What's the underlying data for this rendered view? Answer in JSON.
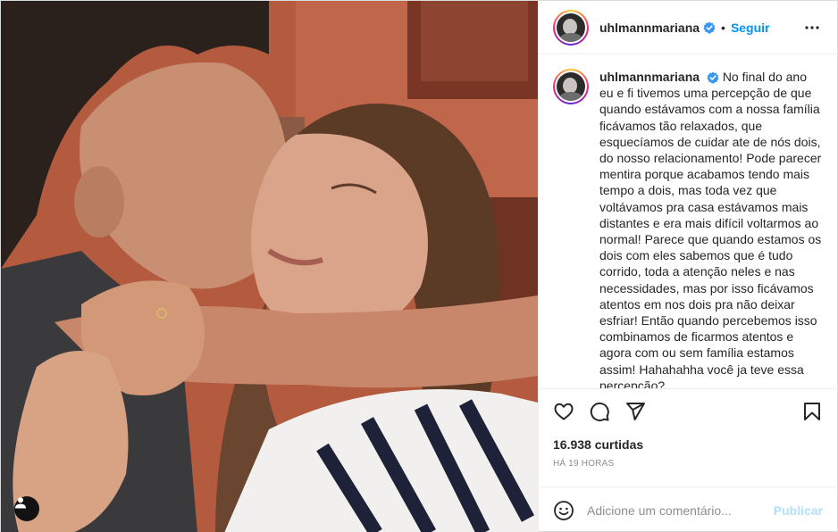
{
  "post": {
    "username": "uhlmannmariana",
    "separator": "•",
    "follow_label": "Seguir",
    "caption": "No final do ano eu e fi tivemos uma percepção de que quando estávamos com a nossa família ficávamos tão relaxados, que esquecíamos de cuidar ate de nós dois, do nosso relacionamento! Pode parecer mentira porque acabamos tendo mais tempo a dois, mas toda vez que voltávamos pra casa estávamos mais distantes e era mais difícil voltarmos ao normal! Parece que quando estamos os dois com eles sabemos que é tudo corrido, toda a atenção neles e nas necessidades, mas por isso ficávamos atentos em nos dois pra não deixar esfriar! Então quando percebemos isso combinamos de ficarmos atentos e agora com ou sem família estamos assim! Hahahahha você ja teve essa percepção?",
    "likes": "16.938 curtidas",
    "timestamp": "HÁ 19 HORAS"
  },
  "comment_box": {
    "placeholder": "Adicione um comentário...",
    "publish_label": "Publicar"
  },
  "icons": {
    "verified": "verified-badge-icon",
    "more": "more-options-icon",
    "like": "heart-icon",
    "comment": "comment-icon",
    "share": "share-icon",
    "save": "bookmark-icon",
    "emoji": "emoji-icon",
    "tags": "user-tag-icon"
  },
  "colors": {
    "accent": "#0095f6",
    "publish_disabled": "#b2dffc",
    "text": "#262626",
    "muted": "#8e8e8e",
    "verified": "#3897f0"
  }
}
